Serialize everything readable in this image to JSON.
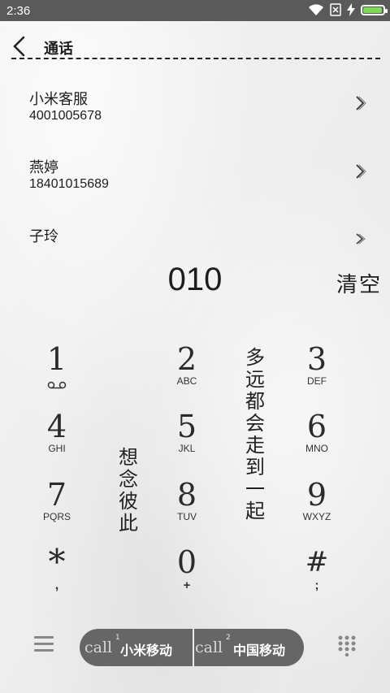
{
  "status_bar": {
    "time": "2:36",
    "battery_level": 0.95,
    "icons": [
      "wifi-icon",
      "no-sim-icon",
      "charging-icon",
      "battery-icon"
    ]
  },
  "header": {
    "title": "通话",
    "back_icon": "chevron-left-icon"
  },
  "contacts": [
    {
      "name": "小米客服",
      "number": "4001005678"
    },
    {
      "name": "燕婷",
      "number": "18401015689"
    },
    {
      "name": "子玲",
      "number": ""
    }
  ],
  "dialer": {
    "dialed_number": "010",
    "clear_label": "清空"
  },
  "keypad": [
    {
      "digit": "1",
      "letters": "",
      "icon": "voicemail-icon"
    },
    {
      "digit": "2",
      "letters": "ABC"
    },
    {
      "digit": "3",
      "letters": "DEF"
    },
    {
      "digit": "4",
      "letters": "GHI"
    },
    {
      "digit": "5",
      "letters": "JKL"
    },
    {
      "digit": "6",
      "letters": "MNO"
    },
    {
      "digit": "7",
      "letters": "PQRS"
    },
    {
      "digit": "8",
      "letters": "TUV"
    },
    {
      "digit": "9",
      "letters": "WXYZ"
    },
    {
      "digit": "*",
      "letters": ","
    },
    {
      "digit": "0",
      "letters": "+"
    },
    {
      "digit": "#",
      "letters": ";"
    }
  ],
  "decor_text": {
    "left": "想念彼此",
    "right": "多远都会走到一起"
  },
  "bottom_bar": {
    "menu_icon": "hamburger-menu-icon",
    "sim1": {
      "call": "call",
      "slot": "1",
      "operator": "小米移动"
    },
    "sim2": {
      "call": "call",
      "slot": "2",
      "operator": "中国移动"
    },
    "dialpad_icon": "dialpad-icon"
  },
  "colors": {
    "status_bar": "#5a5a5a",
    "call_bar": "#666666",
    "battery": "#7ed957"
  }
}
